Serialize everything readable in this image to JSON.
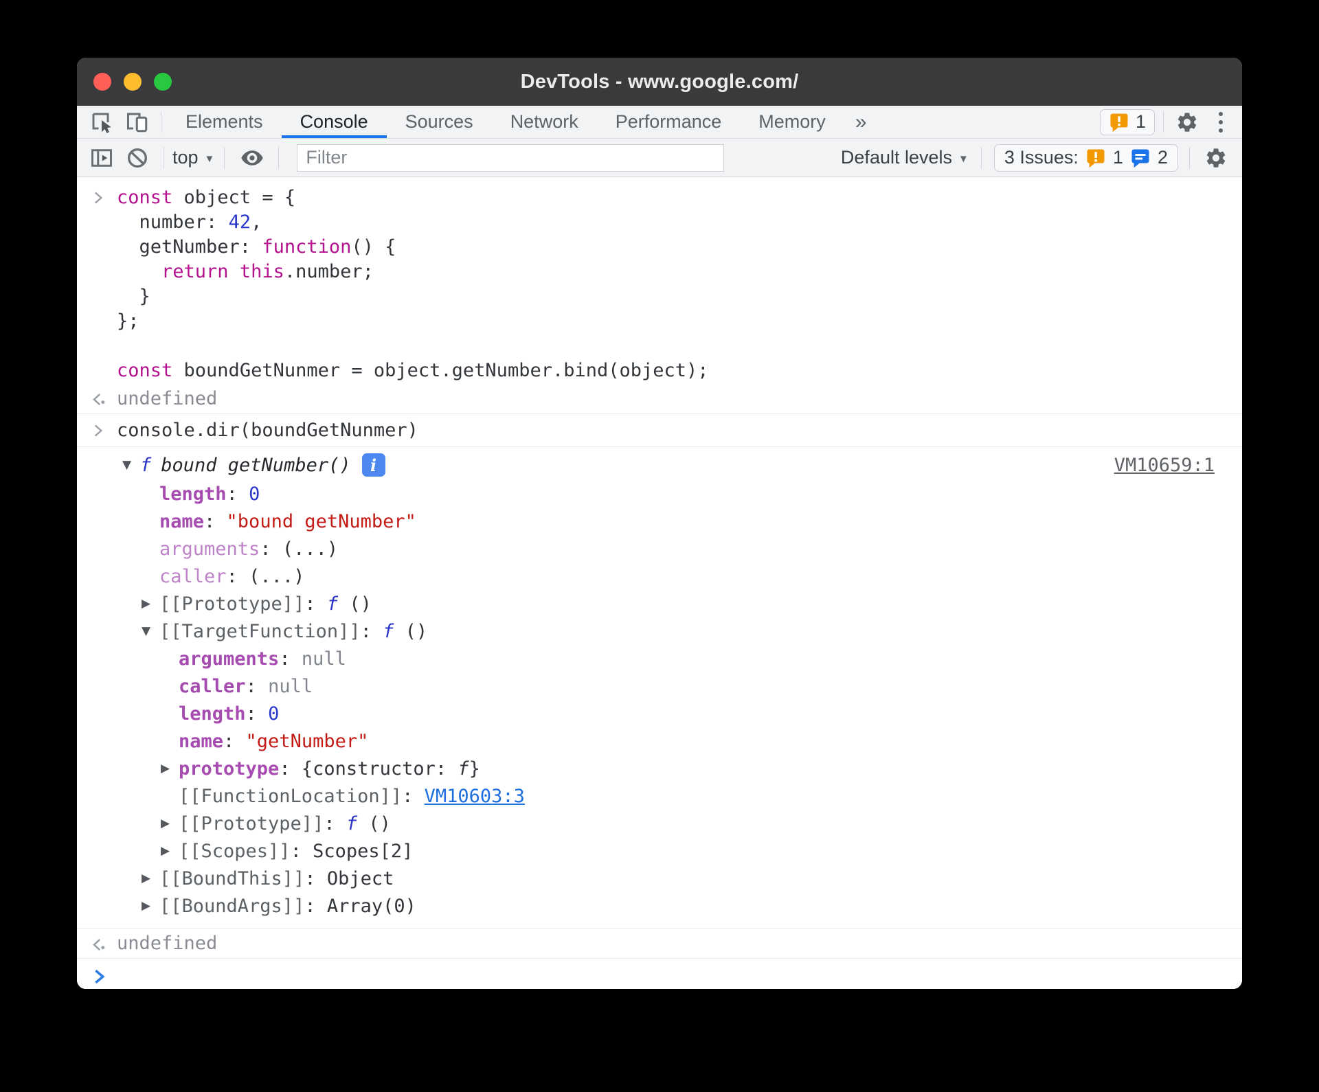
{
  "window": {
    "title": "DevTools - www.google.com/"
  },
  "tabs": {
    "items": [
      "Elements",
      "Console",
      "Sources",
      "Network",
      "Performance",
      "Memory"
    ],
    "active": "Console",
    "more_label": "»",
    "error_badge_count": "1"
  },
  "toolbar": {
    "context_label": "top",
    "caret": "▼",
    "filter_placeholder": "Filter",
    "levels_label": "Default levels",
    "issues_label": "3 Issues:",
    "issue_error_count": "1",
    "issue_message_count": "2"
  },
  "console": {
    "input1": {
      "lines": [
        [
          {
            "t": "const",
            "c": "kw"
          },
          {
            "t": " object = {",
            "c": "plain"
          }
        ],
        [
          {
            "t": "  number: ",
            "c": "plain"
          },
          {
            "t": "42",
            "c": "num"
          },
          {
            "t": ",",
            "c": "plain"
          }
        ],
        [
          {
            "t": "  getNumber: ",
            "c": "plain"
          },
          {
            "t": "function",
            "c": "kw"
          },
          {
            "t": "() {",
            "c": "plain"
          }
        ],
        [
          {
            "t": "    ",
            "c": "plain"
          },
          {
            "t": "return",
            "c": "kw"
          },
          {
            "t": " ",
            "c": "plain"
          },
          {
            "t": "this",
            "c": "kw"
          },
          {
            "t": ".number;",
            "c": "plain"
          }
        ],
        [
          {
            "t": "  }",
            "c": "plain"
          }
        ],
        [
          {
            "t": "};",
            "c": "plain"
          }
        ],
        [],
        [
          {
            "t": "const",
            "c": "kw"
          },
          {
            "t": " boundGetNunmer = object.getNumber.bind(object);",
            "c": "plain"
          }
        ]
      ]
    },
    "result1": "undefined",
    "input2": {
      "text": "console.dir(boundGetNunmer)"
    },
    "output": {
      "header": {
        "fsymbol": "f",
        "title": "bound getNumber()",
        "badge": "i",
        "source_link": "VM10659:1"
      },
      "rows": [
        {
          "indent": 1,
          "tw": "none",
          "segs": [
            {
              "t": "length",
              "c": "propB"
            },
            {
              "t": ": ",
              "c": "plain"
            },
            {
              "t": "0",
              "c": "num"
            }
          ]
        },
        {
          "indent": 1,
          "tw": "none",
          "segs": [
            {
              "t": "name",
              "c": "propB"
            },
            {
              "t": ": ",
              "c": "plain"
            },
            {
              "t": "\"bound getNumber\"",
              "c": "str"
            }
          ]
        },
        {
          "indent": 1,
          "tw": "none",
          "segs": [
            {
              "t": "arguments",
              "c": "prop"
            },
            {
              "t": ": ",
              "c": "plain"
            },
            {
              "t": "(...)",
              "c": "plain",
              "i": true
            }
          ]
        },
        {
          "indent": 1,
          "tw": "none",
          "segs": [
            {
              "t": "caller",
              "c": "prop"
            },
            {
              "t": ": ",
              "c": "plain"
            },
            {
              "t": "(...)",
              "c": "plain",
              "i": true
            }
          ]
        },
        {
          "indent": 1,
          "tw": "right",
          "segs": [
            {
              "t": "[[Prototype]]",
              "c": "internal"
            },
            {
              "t": ": ",
              "c": "plain"
            },
            {
              "t": "f ",
              "c": "fn"
            },
            {
              "t": "()",
              "c": "plain"
            }
          ]
        },
        {
          "indent": 1,
          "tw": "down",
          "segs": [
            {
              "t": "[[TargetFunction]]",
              "c": "internal"
            },
            {
              "t": ": ",
              "c": "plain"
            },
            {
              "t": "f ",
              "c": "fn"
            },
            {
              "t": "()",
              "c": "plain"
            }
          ]
        },
        {
          "indent": 2,
          "tw": "none",
          "segs": [
            {
              "t": "arguments",
              "c": "propB"
            },
            {
              "t": ": ",
              "c": "plain"
            },
            {
              "t": "null",
              "c": "muted"
            }
          ]
        },
        {
          "indent": 2,
          "tw": "none",
          "segs": [
            {
              "t": "caller",
              "c": "propB"
            },
            {
              "t": ": ",
              "c": "plain"
            },
            {
              "t": "null",
              "c": "muted"
            }
          ]
        },
        {
          "indent": 2,
          "tw": "none",
          "segs": [
            {
              "t": "length",
              "c": "propB"
            },
            {
              "t": ": ",
              "c": "plain"
            },
            {
              "t": "0",
              "c": "num"
            }
          ]
        },
        {
          "indent": 2,
          "tw": "none",
          "segs": [
            {
              "t": "name",
              "c": "propB"
            },
            {
              "t": ": ",
              "c": "plain"
            },
            {
              "t": "\"getNumber\"",
              "c": "str"
            }
          ]
        },
        {
          "indent": 2,
          "tw": "right",
          "segs": [
            {
              "t": "prototype",
              "c": "propB"
            },
            {
              "t": ": ",
              "c": "plain"
            },
            {
              "t": "{constructor: ",
              "c": "plain"
            },
            {
              "t": "f",
              "c": "fnDark"
            },
            {
              "t": "}",
              "c": "plain"
            }
          ]
        },
        {
          "indent": 2,
          "tw": "none",
          "segs": [
            {
              "t": "[[FunctionLocation]]",
              "c": "internal"
            },
            {
              "t": ": ",
              "c": "plain"
            },
            {
              "t": "VM10603:3",
              "c": "linkblue",
              "i": true
            }
          ]
        },
        {
          "indent": 2,
          "tw": "right",
          "segs": [
            {
              "t": "[[Prototype]]",
              "c": "internal"
            },
            {
              "t": ": ",
              "c": "plain"
            },
            {
              "t": "f ",
              "c": "fn"
            },
            {
              "t": "()",
              "c": "plain"
            }
          ]
        },
        {
          "indent": 2,
          "tw": "right",
          "segs": [
            {
              "t": "[[Scopes]]",
              "c": "internal"
            },
            {
              "t": ": ",
              "c": "plain"
            },
            {
              "t": "Scopes[2]",
              "c": "plain"
            }
          ]
        },
        {
          "indent": 1,
          "tw": "right",
          "segs": [
            {
              "t": "[[BoundThis]]",
              "c": "internal"
            },
            {
              "t": ": ",
              "c": "plain"
            },
            {
              "t": "Object",
              "c": "plain"
            }
          ]
        },
        {
          "indent": 1,
          "tw": "right",
          "segs": [
            {
              "t": "[[BoundArgs]]",
              "c": "internal"
            },
            {
              "t": ": ",
              "c": "plain"
            },
            {
              "t": "Array(0)",
              "c": "plain"
            }
          ]
        }
      ]
    },
    "result2": "undefined"
  },
  "colors": {
    "accent_blue": "#1a73e8",
    "keyword": "#b5128f",
    "number": "#2a38cc",
    "string": "#c41a16",
    "property": "#a64bb0",
    "property_dim": "#be82c8",
    "internal_slot": "#5c6166",
    "link_blue": "#1d6fe0",
    "issue_warning": "#f29900",
    "titlebar_bg": "#3a3a3c",
    "toolbar_bg": "#f1f3f4"
  }
}
